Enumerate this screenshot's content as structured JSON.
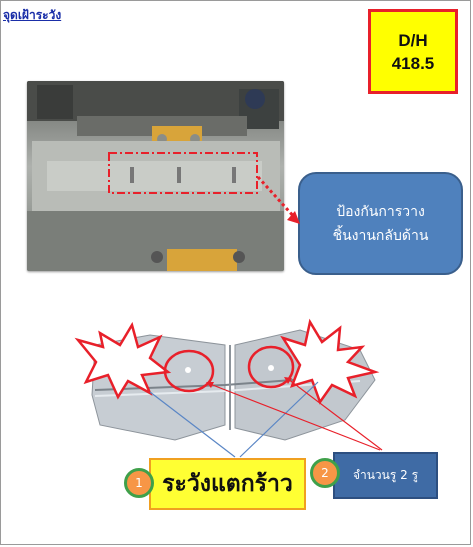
{
  "header": {
    "title": "จุดเฝ้าระวัง"
  },
  "dh_box": {
    "line1": "D/H",
    "line2": "418.5"
  },
  "callout": {
    "line1": "ป้องกันการวาง",
    "line2": "ชิ้นงานกลับด้าน"
  },
  "markers": [
    {
      "number": "1",
      "label": "ระวังแตกร้าว"
    },
    {
      "number": "2",
      "label": "จำนวนรู 2 รู"
    }
  ],
  "colors": {
    "accent_red": "#e8202a",
    "callout_blue": "#4f81bd",
    "caution_yellow": "#ffff33",
    "badge_orange": "#f79646",
    "badge_ring_green": "#3fa04a"
  }
}
